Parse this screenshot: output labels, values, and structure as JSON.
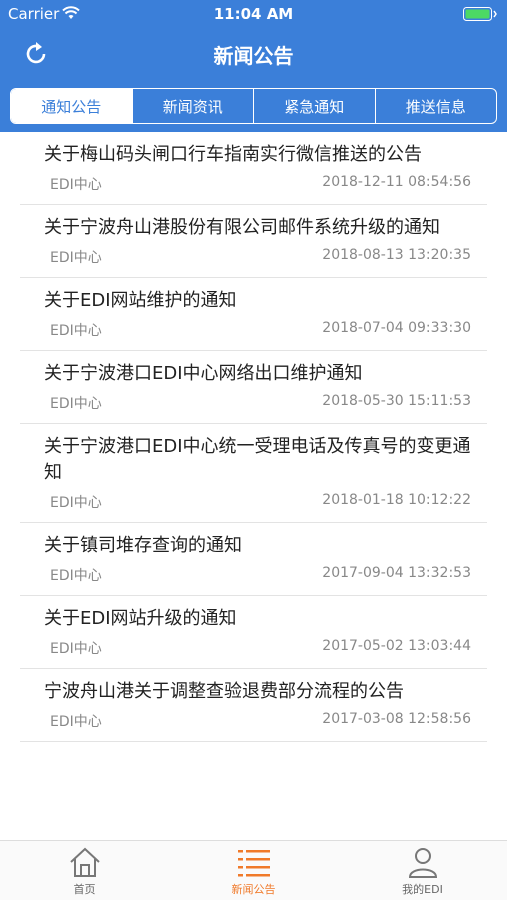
{
  "status": {
    "carrier": "Carrier",
    "time": "11:04 AM"
  },
  "header": {
    "title": "新闻公告"
  },
  "tabs": [
    {
      "label": "通知公告",
      "active": true
    },
    {
      "label": "新闻资讯",
      "active": false
    },
    {
      "label": "紧急通知",
      "active": false
    },
    {
      "label": "推送信息",
      "active": false
    }
  ],
  "items": [
    {
      "title": "关于梅山码头闸口行车指南实行微信推送的公告",
      "source": "EDI中心",
      "date": "2018-12-11 08:54:56"
    },
    {
      "title": "关于宁波舟山港股份有限公司邮件系统升级的通知",
      "source": "EDI中心",
      "date": "2018-08-13 13:20:35"
    },
    {
      "title": "关于EDI网站维护的通知",
      "source": "EDI中心",
      "date": "2018-07-04 09:33:30"
    },
    {
      "title": "关于宁波港口EDI中心网络出口维护通知",
      "source": "EDI中心",
      "date": "2018-05-30 15:11:53"
    },
    {
      "title": "关于宁波港口EDI中心统一受理电话及传真号的变更通知",
      "source": "EDI中心",
      "date": "2018-01-18 10:12:22"
    },
    {
      "title": "关于镇司堆存查询的通知",
      "source": "EDI中心",
      "date": "2017-09-04 13:32:53"
    },
    {
      "title": "关于EDI网站升级的通知",
      "source": "EDI中心",
      "date": "2017-05-02 13:03:44"
    },
    {
      "title": "宁波舟山港关于调整查验退费部分流程的公告",
      "source": "EDI中心",
      "date": "2017-03-08 12:58:56"
    }
  ],
  "tabbar": [
    {
      "label": "首页",
      "icon": "home-icon",
      "active": false
    },
    {
      "label": "新闻公告",
      "icon": "list-icon",
      "active": true
    },
    {
      "label": "我的EDI",
      "icon": "user-icon",
      "active": false
    }
  ],
  "colors": {
    "brand": "#3b7fd9",
    "active_tab": "#f07a2a"
  }
}
